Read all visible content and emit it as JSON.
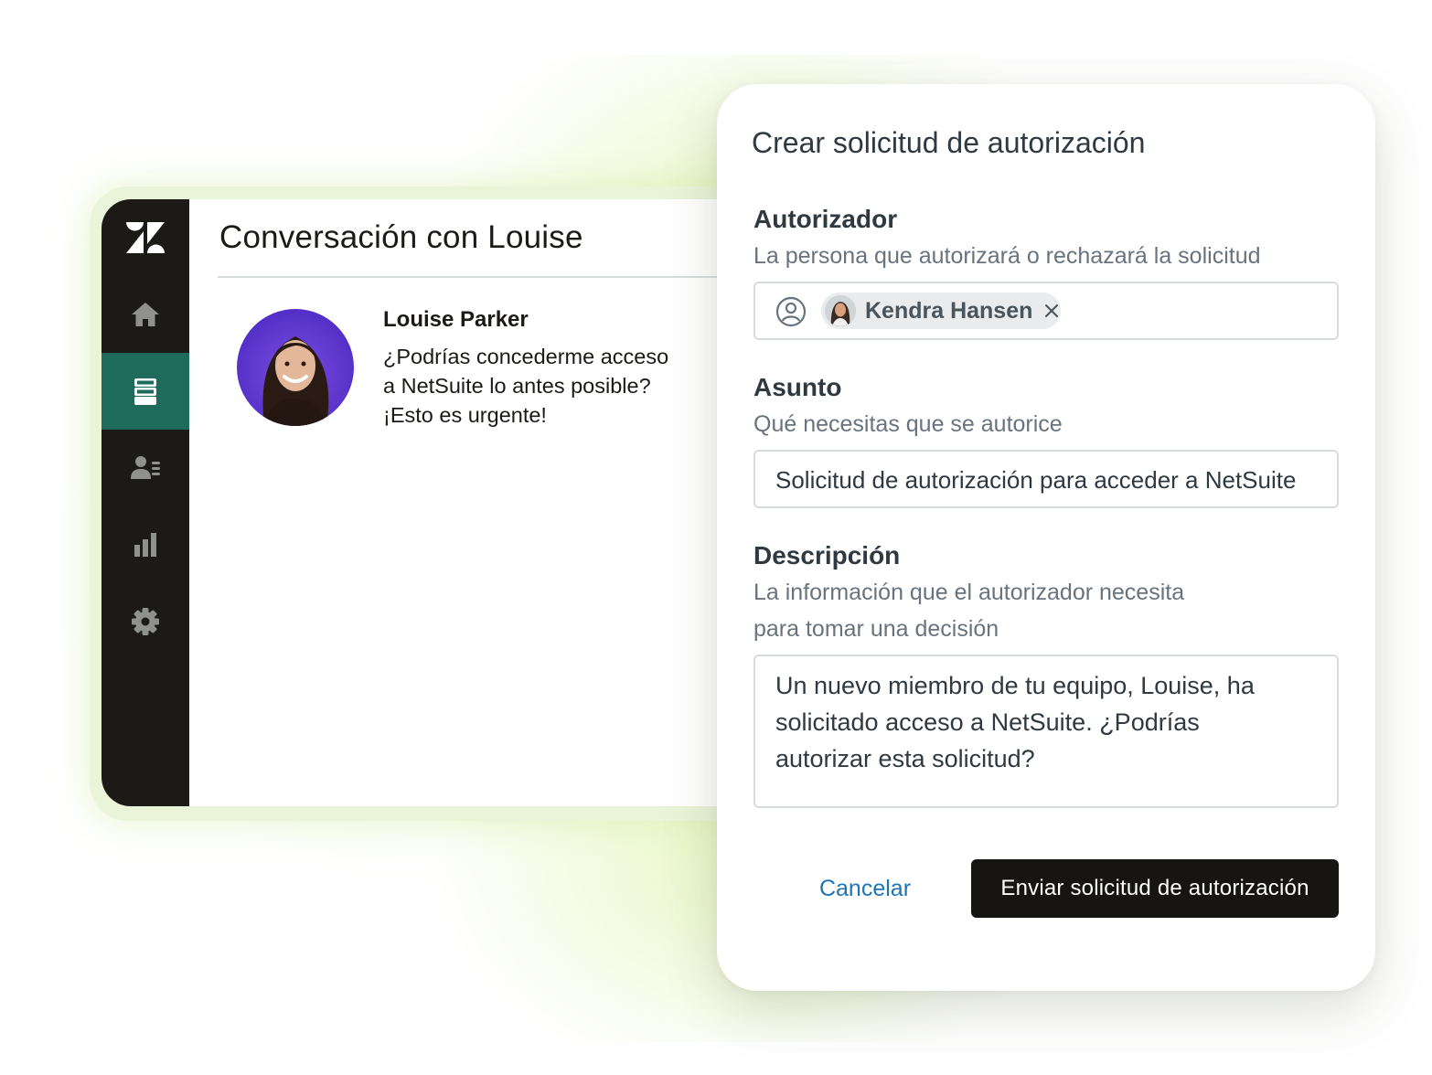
{
  "conversation": {
    "title": "Conversación con Louise",
    "sender_name": "Louise Parker",
    "message_lines": [
      "¿Podrías concederme acceso",
      "a NetSuite lo antes posible?",
      "¡Esto es urgente!"
    ]
  },
  "sidebar": {
    "items": [
      {
        "icon": "home-icon"
      },
      {
        "icon": "tickets-icon",
        "active": true
      },
      {
        "icon": "customers-icon"
      },
      {
        "icon": "reports-icon"
      },
      {
        "icon": "settings-icon"
      }
    ],
    "active_color": "#1e6b5c",
    "background_color": "#1b1a17"
  },
  "dialog": {
    "title": "Crear solicitud de autorización",
    "approver": {
      "label": "Autorizador",
      "hint": "La persona que autorizará o rechazará la solicitud",
      "selected": "Kendra Hansen"
    },
    "subject": {
      "label": "Asunto",
      "hint": "Qué necesitas que se autorice",
      "value": "Solicitud de autorización para acceder a NetSuite"
    },
    "description": {
      "label": "Descripción",
      "hint_lines": [
        "La información que el autorizador necesita",
        "para tomar una decisión"
      ],
      "value_lines": [
        "Un nuevo miembro de tu equipo, Louise, ha",
        "solicitado acceso a NetSuite. ¿Podrías",
        "autorizar esta solicitud?"
      ]
    },
    "cancel_label": "Cancelar",
    "submit_label": "Enviar solicitud de autorización"
  }
}
